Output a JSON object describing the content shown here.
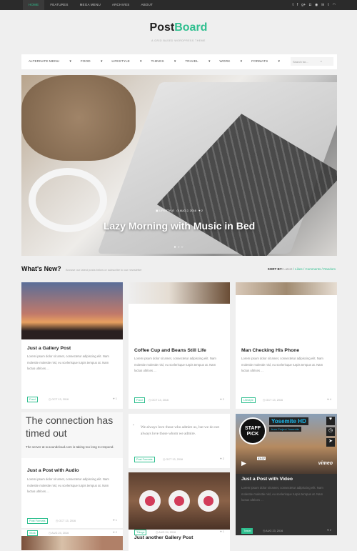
{
  "topbar": {
    "nav": [
      "HOME",
      "FEATURES",
      "MEGA MENU",
      "ARCHIVES",
      "ABOUT"
    ],
    "social_icons": [
      "twitter-icon",
      "facebook-icon",
      "google-plus-icon",
      "instagram-icon",
      "pinterest-icon",
      "linkedin-icon",
      "tumblr-icon",
      "rss-icon"
    ]
  },
  "brand": {
    "logo_dark": "Post",
    "logo_accent": "Board",
    "tagline": "A GRID BASED WORDPRESS THEME",
    "accent": "#2fbf8f"
  },
  "mainnav": {
    "items": [
      "ALTERNATE MENU",
      "FOOD",
      "LIFESTYLE",
      "THINGS",
      "TRAVEL",
      "WORK",
      "FORMATS"
    ],
    "search_placeholder": "Search for..."
  },
  "hero": {
    "category": "LIFESTYLE",
    "date": "AUG 2, 2016",
    "likes": "2",
    "title": "Lazy Morning with Music in Bed"
  },
  "whatsnew": {
    "title": "What's New?",
    "subtitle": "Browse our latest posts below or subscribe to our newsletter",
    "sort_label": "SORT BY:",
    "sort_options": [
      "Latest",
      "Likes",
      "Comments",
      "Random"
    ]
  },
  "excerpt": "Lorem ipsum dolor sit amet, consectetur adipiscing elit. Nam molestie molestie nisl, eu scelerisque turpis tempus at. Nam luctus ultrices ...",
  "cards": [
    {
      "title": "Just a Gallery Post",
      "tag": "Food",
      "date": "OCT 13, 2016",
      "likes": "1"
    },
    {
      "title": "Coffee Cup and Beans Still Life",
      "tag": "Food",
      "date": "OCT 13, 2016",
      "likes": "2"
    },
    {
      "title": "Man Checking His Phone",
      "tag": "Lifestyle",
      "date": "OCT 13, 2016",
      "likes": "4"
    },
    {
      "title": "Just a Post with Audio",
      "tag": "Post Formats",
      "date": "OCT 13, 2016",
      "likes": "1",
      "error_title": "The connection has timed out",
      "error_text": "The server at w.soundcloud.com is taking too long to respond."
    },
    {
      "quote": "We always love those who admire us, but we do not always love those whom we admire.",
      "tag": "Post Formats",
      "date": "OCT 13, 2016",
      "likes": "2"
    },
    {
      "title": "Just another Gallery Post",
      "tag": "Things",
      "date": "AUG 24, 2016",
      "likes": "1"
    },
    {
      "title": "Just a Post with Video",
      "tag": "Travel",
      "date": "AUG 23, 2016",
      "likes": "2",
      "video_title": "Yosemite HD",
      "video_from": "from Project Yosemite",
      "video_time": "03:37",
      "badge": "STAFF PICK",
      "player": "vimeo"
    },
    {
      "tag": "Work",
      "date": "AUG 24, 2016",
      "likes": "2"
    }
  ]
}
